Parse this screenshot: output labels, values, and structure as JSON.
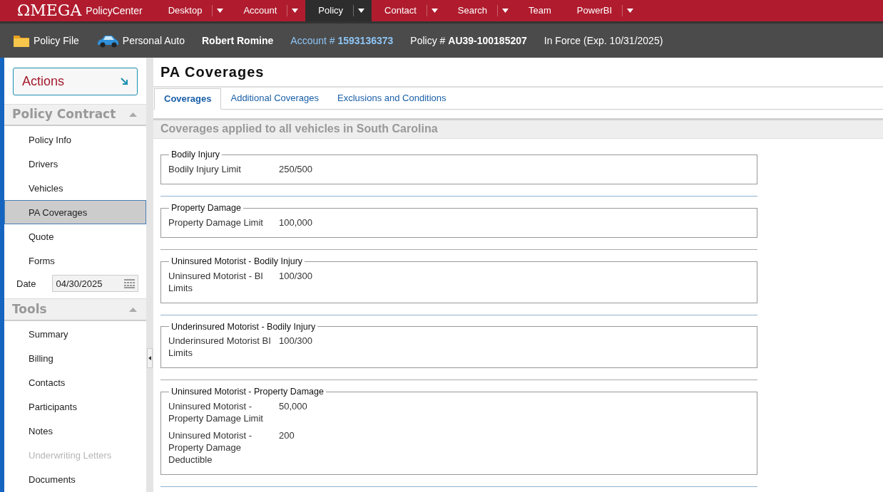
{
  "app": {
    "logo": "ΩMEGA",
    "product": "PolicyCenter"
  },
  "nav": [
    {
      "label": "Desktop",
      "dropdown": true,
      "selected": false
    },
    {
      "label": "Account",
      "dropdown": true,
      "selected": false
    },
    {
      "label": "Policy",
      "dropdown": true,
      "selected": true
    },
    {
      "label": "Contact",
      "dropdown": true,
      "selected": false
    },
    {
      "label": "Search",
      "dropdown": true,
      "selected": false
    },
    {
      "label": "Team",
      "dropdown": false,
      "selected": false
    },
    {
      "label": "PowerBI",
      "dropdown": true,
      "selected": false
    }
  ],
  "infobar": {
    "policy_file": "Policy File",
    "product": "Personal Auto",
    "insured": "Robert Romine",
    "account_label": "Account #",
    "account_number": "1593136373",
    "policy_label": "Policy #",
    "policy_number": "AU39-100185207",
    "status": "In Force (Exp. 10/31/2025)"
  },
  "sidebar": {
    "actions": "Actions",
    "sections": [
      {
        "title": "Policy Contract",
        "expanded": true,
        "items": [
          {
            "label": "Policy Info",
            "selected": false,
            "disabled": false
          },
          {
            "label": "Drivers",
            "selected": false,
            "disabled": false
          },
          {
            "label": "Vehicles",
            "selected": false,
            "disabled": false
          },
          {
            "label": "PA Coverages",
            "selected": true,
            "disabled": false
          },
          {
            "label": "Quote",
            "selected": false,
            "disabled": false
          },
          {
            "label": "Forms",
            "selected": false,
            "disabled": false
          }
        ],
        "date": {
          "label": "Date",
          "value": "04/30/2025"
        }
      },
      {
        "title": "Tools",
        "expanded": true,
        "items": [
          {
            "label": "Summary",
            "selected": false,
            "disabled": false
          },
          {
            "label": "Billing",
            "selected": false,
            "disabled": false
          },
          {
            "label": "Contacts",
            "selected": false,
            "disabled": false
          },
          {
            "label": "Participants",
            "selected": false,
            "disabled": false
          },
          {
            "label": "Notes",
            "selected": false,
            "disabled": false
          },
          {
            "label": "Underwriting Letters",
            "selected": false,
            "disabled": true
          },
          {
            "label": "Documents",
            "selected": false,
            "disabled": false
          }
        ]
      }
    ]
  },
  "page": {
    "title": "PA Coverages",
    "tabs": [
      {
        "label": "Coverages",
        "selected": true
      },
      {
        "label": "Additional Coverages",
        "selected": false
      },
      {
        "label": "Exclusions and Conditions",
        "selected": false
      }
    ],
    "section_title": "Coverages applied to all vehicles in South Carolina",
    "groups": [
      {
        "title": "Bodily Injury",
        "rows": [
          {
            "label": "Bodily Injury Limit",
            "value": "250/500"
          }
        ]
      },
      {
        "title": "Property Damage",
        "rows": [
          {
            "label": "Property Damage Limit",
            "value": "100,000"
          }
        ]
      },
      {
        "title": "Uninsured Motorist - Bodily Injury",
        "rows": [
          {
            "label": "Uninsured Motorist - BI Limits",
            "value": "100/300"
          }
        ]
      },
      {
        "title": "Underinsured Motorist - Bodily Injury",
        "rows": [
          {
            "label": "Underinsured Motorist BI Limits",
            "value": "100/300"
          }
        ]
      },
      {
        "title": "Uninsured Motorist - Property Damage",
        "rows": [
          {
            "label": "Uninsured Motorist - Property Damage Limit",
            "value": "50,000"
          },
          {
            "label": "Uninsured Motorist - Property Damage Deductible",
            "value": "200"
          }
        ]
      }
    ]
  }
}
